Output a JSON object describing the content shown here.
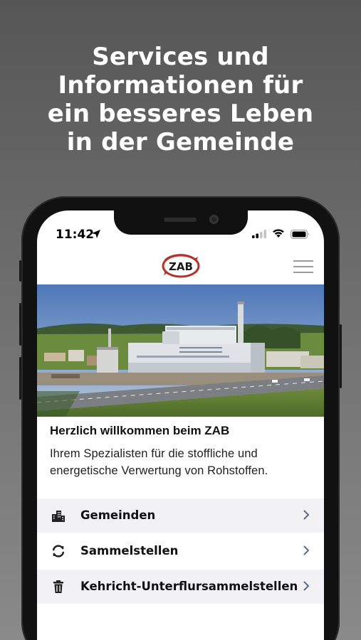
{
  "promo": {
    "headline_lines": [
      "Services und",
      "Informationen für",
      "ein besseres Leben",
      "in der Gemeinde"
    ]
  },
  "status_bar": {
    "time": "11:42"
  },
  "header": {
    "logo_text": "ZAB"
  },
  "welcome": {
    "title": "Herzlich willkommen beim ZAB",
    "text": "Ihrem Spezialisten für die stoffliche und energetische Verwertung von Rohstoffen."
  },
  "menu": {
    "items": [
      {
        "label": "Gemeinden",
        "icon": "buildings-icon"
      },
      {
        "label": "Sammelstellen",
        "icon": "recycle-icon"
      },
      {
        "label": "Kehricht-Unterflursammelstellen",
        "icon": "trash-icon"
      }
    ]
  },
  "colors": {
    "brand_red": "#b5322c",
    "chevron": "#5b6c8a",
    "row_shade": "#f2f2f4"
  }
}
